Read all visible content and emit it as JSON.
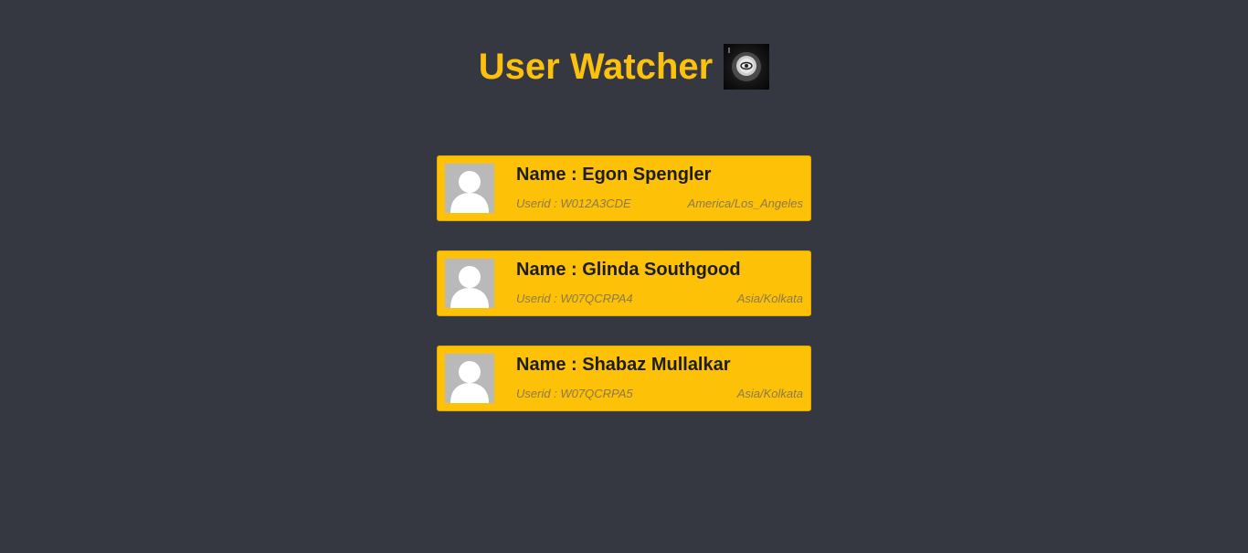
{
  "app": {
    "title": "User Watcher",
    "logo_icon": "eye-icon"
  },
  "users": [
    {
      "name": "Name : Egon Spengler",
      "userid": "Userid : W012A3CDE",
      "timezone": "America/Los_Angeles",
      "avatar_icon": "user-avatar-icon"
    },
    {
      "name": "Name : Glinda Southgood",
      "userid": "Userid : W07QCRPA4",
      "timezone": "Asia/Kolkata",
      "avatar_icon": "user-avatar-icon"
    },
    {
      "name": "Name : Shabaz Mullalkar",
      "userid": "Userid : W07QCRPA5",
      "timezone": "Asia/Kolkata",
      "avatar_icon": "user-avatar-icon"
    }
  ],
  "colors": {
    "background": "#353840",
    "accent": "#fdc107",
    "title": "#fcc10f",
    "card_text": "#1d1d1d",
    "meta_text": "#8a7a4a"
  }
}
